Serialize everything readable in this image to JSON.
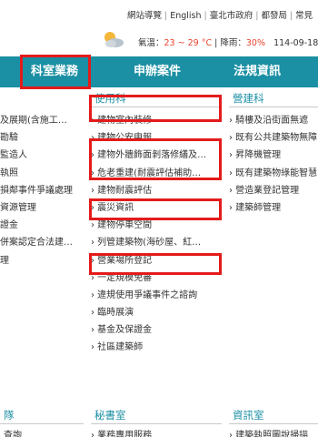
{
  "top_links": [
    "網站導覽",
    "English",
    "臺北市政府",
    "都發局",
    "常見"
  ],
  "weather": {
    "icon": "partly-cloudy-icon",
    "temp_label": "氣溫：",
    "temp_value": "23 ~ 29 °C",
    "sep": "|",
    "rain_label": "降雨：",
    "rain_value": "30%",
    "date": "114-09-18 星"
  },
  "nav": [
    "科室業務",
    "申辦案件",
    "法規資訊"
  ],
  "left_column": {
    "items": [
      "及展期(含施工…",
      "勘驗",
      "監造人",
      "執照",
      "損鄰事件爭議處理",
      "資源管理",
      "證金",
      "併案認定合法建…",
      "理"
    ]
  },
  "middle_column": {
    "title": "使用科",
    "items": [
      "› 建物室內裝修",
      "› 建物公安申報",
      "› 建物外牆飾面剝落修繕及…",
      "› 危老重建(耐震評估補助…",
      "› 建物耐震評估",
      "› 震災資訊",
      "› 建物停車空間",
      "› 列管建築物(海砂屋、紅…",
      "› 營業場所登記",
      "› 一定規模免審",
      "› 違規使用爭議事件之諮詢",
      "› 臨時展演",
      "› 基金及保證金",
      "› 社區建築師"
    ]
  },
  "right_column": {
    "title": "營建科",
    "items": [
      "› 騎樓及沿街面無遮",
      "› 既有公共建築物無障",
      "› 昇降機管理",
      "› 既有建築物綠能智慧",
      "› 營造業登記管理",
      "› 建築師管理"
    ]
  },
  "bottom": {
    "left_title": "隊",
    "left_text": "查詢",
    "mid_title": "秘書室",
    "mid_text": "› 業務專用服務",
    "right_title": "資訊室",
    "right_text": "› 建築執照圖說掃描"
  },
  "highlight_color": "#e41b1b"
}
